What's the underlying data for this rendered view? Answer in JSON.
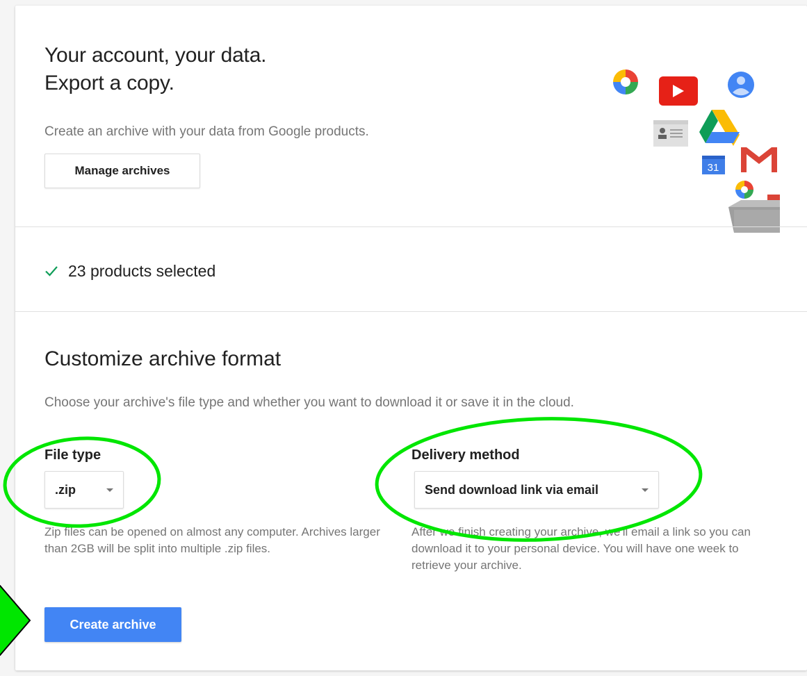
{
  "header": {
    "headline_line1": "Your account, your data.",
    "headline_line2": "Export a copy.",
    "subtitle": "Create an archive with your data from Google products.",
    "manage_archives_label": "Manage archives"
  },
  "products": {
    "selected_text": "23 products selected"
  },
  "format": {
    "title": "Customize archive format",
    "description": "Choose your archive's file type and whether you want to download it or save it in the cloud.",
    "file_type": {
      "label": "File type",
      "selected": ".zip",
      "help": "Zip files can be opened on almost any computer. Archives larger than 2GB will be split into multiple .zip files."
    },
    "delivery": {
      "label": "Delivery method",
      "selected": "Send download link via email",
      "help": "After we finish creating your archive, we'll email a link so you can download it to your personal device. You will have one week to retrieve your archive."
    }
  },
  "actions": {
    "create_archive_label": "Create archive"
  },
  "illustration": {
    "icons": [
      "photos-icon",
      "youtube-icon",
      "contacts-icon",
      "contacts-card-icon",
      "drive-icon",
      "calendar-icon",
      "gmail-icon",
      "hangouts-icon",
      "archive-box-icon"
    ],
    "calendar_day": "31"
  },
  "annotations": {
    "color": "#00e600",
    "items": [
      "file-type-highlight-ellipse",
      "delivery-method-highlight-ellipse",
      "create-archive-arrow"
    ]
  },
  "colors": {
    "accent": "#4285f4",
    "check": "#0f9d58",
    "secondary_text": "#757575"
  }
}
